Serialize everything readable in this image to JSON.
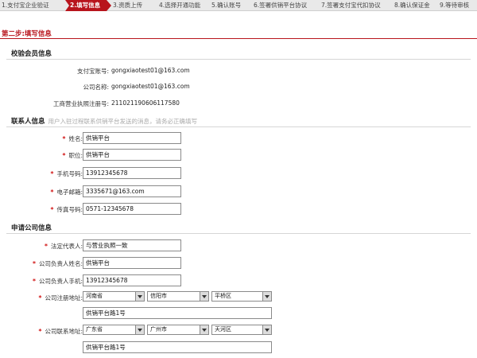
{
  "steps": [
    "1.支付宝企业验证",
    "2.填写信息",
    "3.资质上传",
    "4.选择开通功能",
    "5.确认账号",
    "6.签署供销平台协议",
    "7.签署支付宝代扣协议",
    "8.确认保证金",
    "9.等待审核"
  ],
  "page_title": "第二步:填写信息",
  "verify": {
    "title": "校验会员信息",
    "alipay_label": "支付宝账号:",
    "alipay_value": "gongxiaotest01@163.com",
    "company_label": "公司名称:",
    "company_value": "gongxiaotest01@163.com",
    "license_label": "工商营业执照注册号:",
    "license_value": "211021190606117580"
  },
  "contact": {
    "title": "联系人信息",
    "hint": "用户入驻过程联系供销平台发送的消息，请务必正确填写",
    "name_label": "姓名:",
    "name_value": "供销平台",
    "position_label": "职位:",
    "position_value": "供销平台",
    "mobile_label": "手机号码:",
    "mobile_value": "13912345678",
    "email_label": "电子邮箱:",
    "email_value": "3335671@163.com",
    "fax_label": "传真号码:",
    "fax_value": "0571-12345678"
  },
  "company": {
    "title": "申请公司信息",
    "legal_label": "法定代表人:",
    "legal_value": "与营业执照一致",
    "manager_label": "公司负责人姓名:",
    "manager_value": "供销平台",
    "manager_mobile_label": "公司负责人手机:",
    "manager_mobile_value": "13912345678",
    "reg_addr_label": "公司注册地址:",
    "reg_province": "河南省",
    "reg_city": "信阳市",
    "reg_district": "平桥区",
    "reg_street": "供销平台路1号",
    "contact_addr_label": "公司联系地址:",
    "contact_province": "广东省",
    "contact_city": "广州市",
    "contact_district": "天河区",
    "contact_street": "供销平台路1号"
  },
  "required_mark": "*",
  "colors": {
    "accent": "#b8141c",
    "required": "#d01010"
  }
}
